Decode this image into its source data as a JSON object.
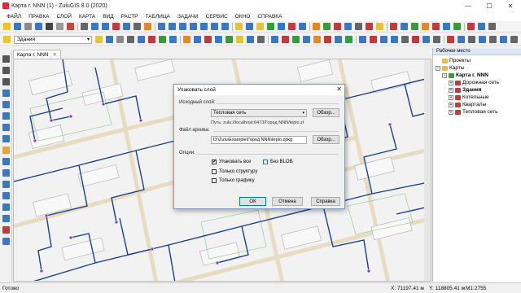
{
  "window": {
    "title": "Карта г. NNN (1) - ZuluGIS 8.0 (2020)",
    "controls": [
      "—",
      "☐",
      "✕"
    ]
  },
  "menu": [
    "ФАЙЛ",
    "ПРАВКА",
    "СЛОЙ",
    "КАРТА",
    "ВИД",
    "РАСТР",
    "ТАБЛИЦА",
    "ЗАДАЧИ",
    "СЕРВИС",
    "ОКНО",
    "СПРАВКА"
  ],
  "toolbar": {
    "layer_select_value": "Здания",
    "icon_colors_row1": [
      "#e8c23a",
      "#3b78c2",
      "#8a8a8a",
      "#3b78c2",
      "#444",
      "#9a9a9a",
      "#c24b3b",
      "#666",
      "#3b78c2",
      "#3b78c2",
      "#c23b3b",
      "#3b78c2",
      "#666",
      "#e08a2a",
      "#3b78c2",
      "#3b78c2",
      "#3b78c2",
      "#3b78c2",
      "#3b78c2",
      "#3b78c2",
      "#3b78c2",
      "#e8c23a",
      "#3b78c2",
      "#e8c23a",
      "#3b9a3b",
      "#2a7bd0",
      "#c23b3b",
      "#3b78c2",
      "#e08a2a",
      "#3b9a3b",
      "#c23b3b",
      "#3b78c2",
      "#666",
      "#c23b3b",
      "#e8c23a",
      "#c23b3b",
      "#3b78c2",
      "#3b9a3b",
      "#e08a2a",
      "#c23b3b",
      "#3b78c2",
      "#3b9a3b",
      "#c23b3b",
      "#3b78c2",
      "#666"
    ],
    "icon_colors_row2": [
      "#e8c23a",
      "#3b78c2",
      "#8a8a8a",
      "#666",
      "#3b78c2",
      "#c23b3b",
      "#3b9a3b",
      "#3b78c2",
      "#e08a2a",
      "#3b78c2",
      "#c23b3b",
      "#3b78c2",
      "#3b9a3b",
      "#e8c23a",
      "#3b78c2",
      "#666",
      "#3b78c2",
      "#c23b3b",
      "#3b9a3b",
      "#3b78c2",
      "#e08a2a",
      "#c23b3b",
      "#3b78c2",
      "#3b9a3b",
      "#3b78c2",
      "#c23b3b",
      "#3b78c2",
      "#3b78c2",
      "#666",
      "#c23b3b",
      "#3b78c2",
      "#666",
      "#c23b3b",
      "#3b78c2",
      "#666",
      "#3b78c2",
      "#666",
      "#3b78c2",
      "#666"
    ]
  },
  "left_tools": [
    "#555",
    "#555",
    "#555",
    "#3b78c2",
    "#3b78c2",
    "#3b78c2",
    "#3b78c2",
    "#3b78c2",
    "#e8a33a",
    "#3b78c2",
    "#3b78c2",
    "#3b78c2",
    "#3b78c2",
    "#3b78c2",
    "#3b78c2",
    "#c23b3b",
    "#3b78c2"
  ],
  "document_tab": {
    "label": "Карта г. NNN",
    "close": "✕"
  },
  "workspace": {
    "header": "Рабочее место",
    "tree": [
      {
        "label": "Проекты",
        "level": 0,
        "expander": "",
        "icon_color": "#e8c23a",
        "bold": false
      },
      {
        "label": "Карты",
        "level": 0,
        "expander": "−",
        "icon_color": "#e8c23a",
        "bold": false
      },
      {
        "label": "Карта г. NNN",
        "level": 1,
        "expander": "−",
        "icon_color": "#3b9a3b",
        "bold": true
      },
      {
        "label": "Дорожная сеть",
        "level": 2,
        "expander": "+",
        "icon_color": "#c23b3b",
        "bold": false
      },
      {
        "label": "Здания",
        "level": 2,
        "expander": "+",
        "icon_color": "#c23b3b",
        "bold": true
      },
      {
        "label": "Котельные",
        "level": 2,
        "expander": "+",
        "icon_color": "#c23b3b",
        "bold": false
      },
      {
        "label": "Кварталы",
        "level": 2,
        "expander": "+",
        "icon_color": "#c23b3b",
        "bold": false
      },
      {
        "label": "Тепловая сеть",
        "level": 2,
        "expander": "+",
        "icon_color": "#c23b3b",
        "bold": false
      }
    ]
  },
  "status": {
    "ready": "Готово",
    "x": "X: 71197.41 м",
    "y": "Y: 118805.41 м",
    "scale": "М1:2755"
  },
  "dialog": {
    "title": "Упаковать слой",
    "close": "✕",
    "source_group": "Исходный слой:",
    "source_value": "Тепловая сеть",
    "browse1": "Обзор...",
    "path": "Путь: zulu://localhost:6473/Город NNN/teplo.zl",
    "archive_group": "Файл архива:",
    "archive_value": "D:\\Zulu\\Example\\Город NNN\\teplo.zpkg",
    "browse2": "Обзор...",
    "options_group": "Опции:",
    "opt_pack_all": "Упаковать все",
    "opt_pack_all_checked": "✔",
    "opt_no_blob": "Без BLOB",
    "opt_structure_only": "Только структуру",
    "opt_graphics_only": "Только графику",
    "ok": "ОК",
    "cancel": "Отмена",
    "help": "Справка"
  }
}
